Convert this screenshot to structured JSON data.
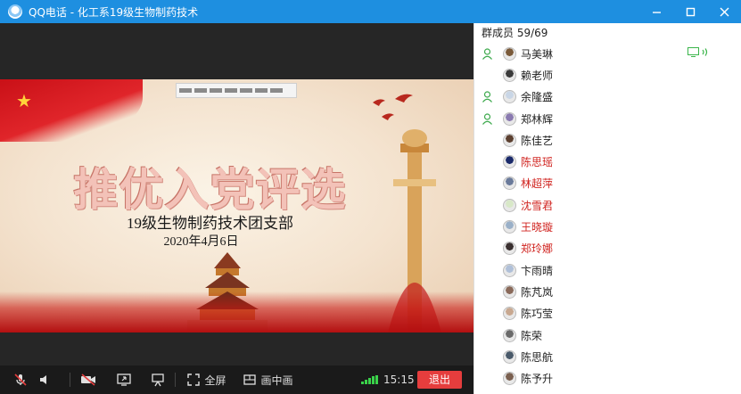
{
  "window": {
    "title": "QQ电话 - 化工系19级生物制药技术"
  },
  "slide": {
    "title": "推优入党评选",
    "subtitle": "19级生物制药技术团支部",
    "date": "2020年4月6日"
  },
  "controls": {
    "fullscreen_label": "全屏",
    "pip_label": "画中画",
    "time": "15:15",
    "exit_label": "退出"
  },
  "members": {
    "header": "群成员 59/69",
    "items": [
      {
        "name": "马美琳",
        "mic": true,
        "red": false,
        "speaking": true,
        "avatar_color": "#7a5a3a"
      },
      {
        "name": "赖老师",
        "mic": false,
        "red": false,
        "speaking": false,
        "avatar_color": "#3b3b3b"
      },
      {
        "name": "余隆盛",
        "mic": true,
        "red": false,
        "speaking": false,
        "avatar_color": "#c9d6e6"
      },
      {
        "name": "郑林辉",
        "mic": true,
        "red": false,
        "speaking": false,
        "avatar_color": "#8a7ab0"
      },
      {
        "name": "陈佳艺",
        "mic": false,
        "red": false,
        "speaking": false,
        "avatar_color": "#5c4030"
      },
      {
        "name": "陈思瑶",
        "mic": false,
        "red": true,
        "speaking": false,
        "avatar_color": "#1a2a6a"
      },
      {
        "name": "林超萍",
        "mic": false,
        "red": true,
        "speaking": false,
        "avatar_color": "#6a7a9a"
      },
      {
        "name": "沈雪君",
        "mic": false,
        "red": true,
        "speaking": false,
        "avatar_color": "#d8e8c8"
      },
      {
        "name": "王晓璇",
        "mic": false,
        "red": true,
        "speaking": false,
        "avatar_color": "#9ab0c8"
      },
      {
        "name": "郑玲娜",
        "mic": false,
        "red": true,
        "speaking": false,
        "avatar_color": "#3a3030"
      },
      {
        "name": "卞雨晴",
        "mic": false,
        "red": false,
        "speaking": false,
        "avatar_color": "#b0c0d8"
      },
      {
        "name": "陈芃岚",
        "mic": false,
        "red": false,
        "speaking": false,
        "avatar_color": "#8a6a5a"
      },
      {
        "name": "陈巧莹",
        "mic": false,
        "red": false,
        "speaking": false,
        "avatar_color": "#c8a890"
      },
      {
        "name": "陈荣",
        "mic": false,
        "red": false,
        "speaking": false,
        "avatar_color": "#6a6a6a"
      },
      {
        "name": "陈思航",
        "mic": false,
        "red": false,
        "speaking": false,
        "avatar_color": "#4a5a6a"
      },
      {
        "name": "陈予升",
        "mic": false,
        "red": false,
        "speaking": false,
        "avatar_color": "#7a6050"
      }
    ]
  },
  "colors": {
    "titlebar": "#1e8fe0",
    "exit_button": "#e53d3d",
    "red_name": "#d0231f",
    "mic_icon": "#3aa84a",
    "speaking_icon": "#3ab54a"
  }
}
